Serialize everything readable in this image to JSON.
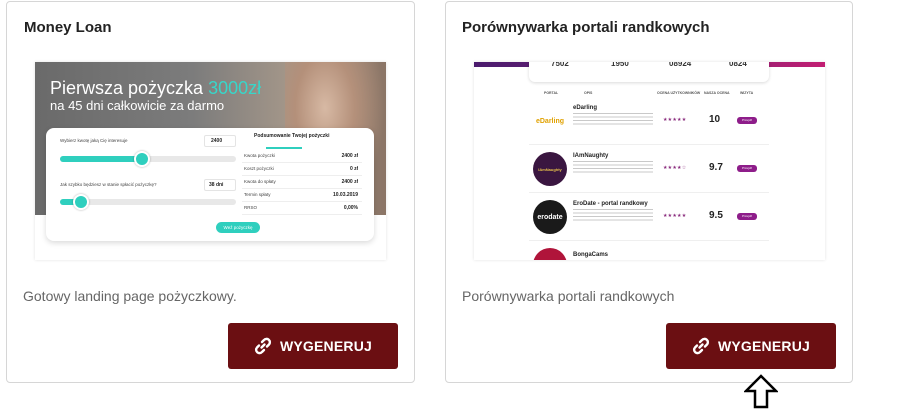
{
  "cards": [
    {
      "title": "Money Loan",
      "description": "Gotowy landing page pożyczkowy.",
      "button_label": "WYGENERUJ",
      "preview": {
        "headline": "Pierwsza pożyczka ",
        "headline_amount": "3000zł",
        "subheadline": "na 45 dni całkowicie za darmo",
        "slider1_label": "Wybierz kwotę jaką Cię interesuje",
        "slider1_value": "2400",
        "slider1_level": 0.45,
        "slider2_label": "Jak szybko będziesz w stanie spłacić pożyczkę?",
        "slider2_value": "38 dni",
        "slider2_level": 0.1,
        "summary_title": "Podsumowanie Twojej pożyczki",
        "summary_rows": [
          {
            "label": "Kwota pożyczki",
            "value": "2400 zł"
          },
          {
            "label": "Koszt pożyczki",
            "value": "0 zł"
          },
          {
            "label": "Kwota do spłaty",
            "value": "2400 zł"
          },
          {
            "label": "Termin spłaty",
            "value": "10.03.2019"
          },
          {
            "label": "RRSO",
            "value": "0,00%"
          }
        ],
        "cta": "Weź pożyczkę"
      }
    },
    {
      "title": "Porównywarka portali randkowych",
      "description": "Porównywarka portali randkowych",
      "button_label": "WYGENERUJ",
      "preview": {
        "stats": [
          "7502",
          "1950",
          "08924",
          "0824"
        ],
        "headers": [
          "PORTAL",
          "OPIS",
          "OCENA UŻYTKOWNIKÓW",
          "NASZA OCENA",
          "WIZYTA"
        ],
        "rows": [
          {
            "logo_text": "eDarling",
            "name": "eDarling",
            "stars": "★★★★★",
            "score": "10",
            "btn": "Przejdź"
          },
          {
            "logo_text": "IAmNaughty",
            "name": "IAmNaughty",
            "stars": "★★★★☆",
            "score": "9.7",
            "btn": "Przejdź"
          },
          {
            "logo_text": "erodate",
            "name": "EroDate - portal randkowy",
            "stars": "★★★★★",
            "score": "9.5",
            "btn": "Przejdź"
          },
          {
            "logo_text": "",
            "name": "BongaCams",
            "stars": "",
            "score": "",
            "btn": ""
          }
        ]
      }
    }
  ],
  "icons": {
    "button_icon": "link-icon",
    "cursor": "arrow-up-cursor-icon"
  },
  "colors": {
    "button_bg": "#6b0f12",
    "accent_teal": "#2fcfbe",
    "accent_purple": "#8e1d8a"
  }
}
